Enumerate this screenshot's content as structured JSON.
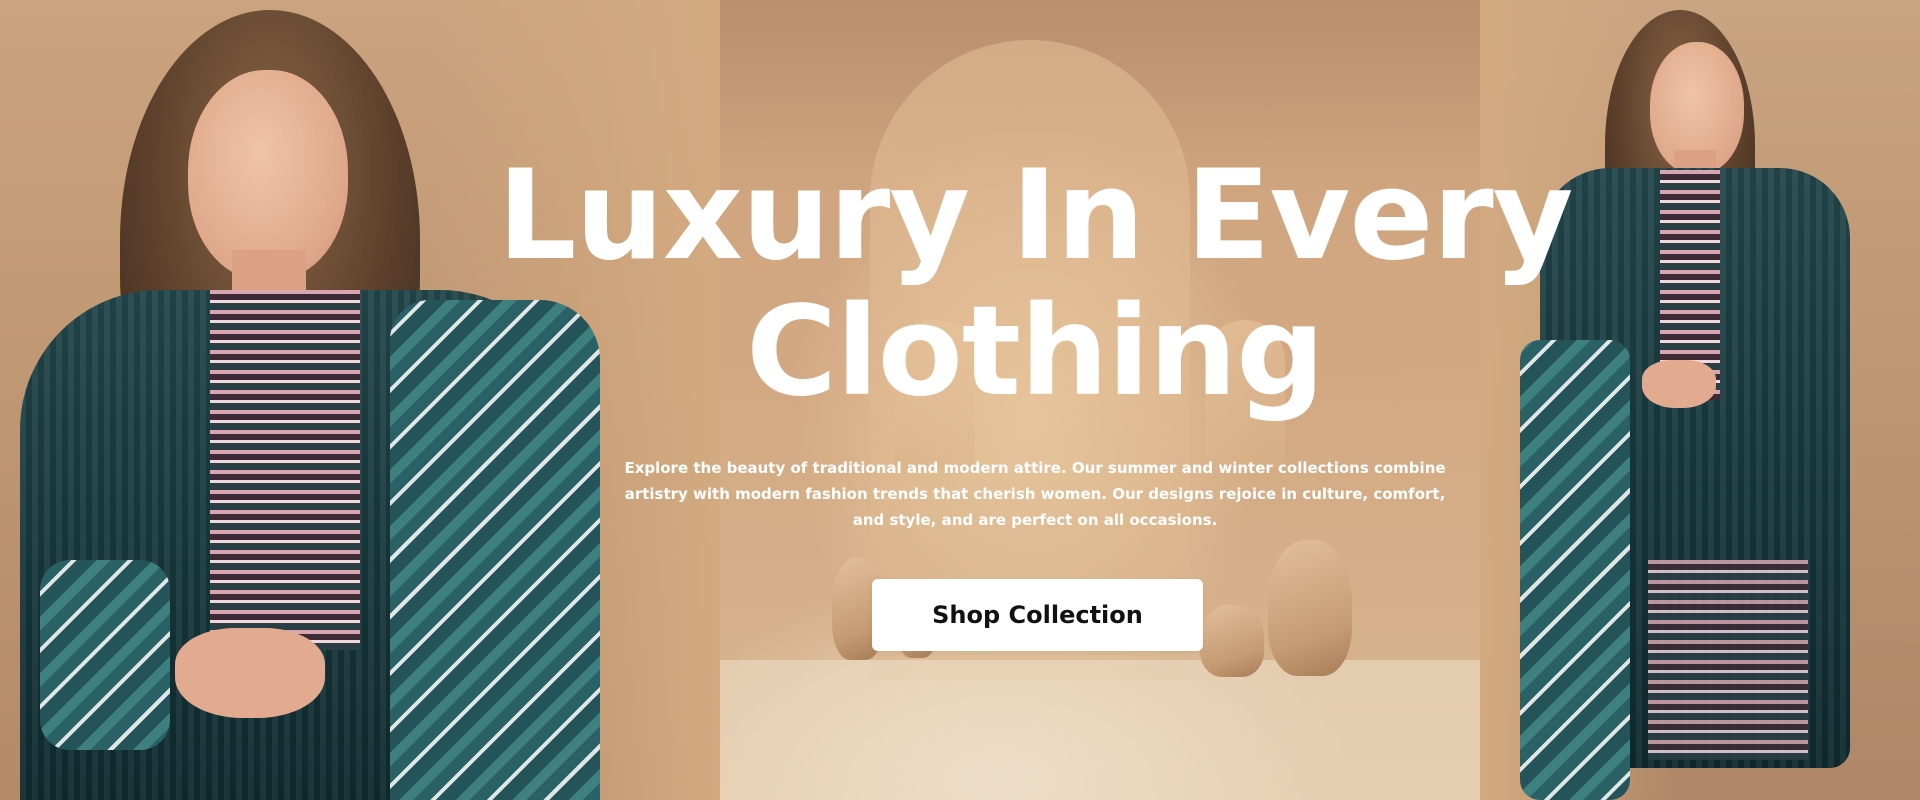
{
  "hero": {
    "headline": "Luxury In Every Clothing",
    "description": "Explore the beauty of traditional and modern attire. Our summer and winter collections combine artistry with modern fashion trends that cherish women. Our designs rejoice in culture, comfort, and style, and are perfect on all occasions.",
    "cta_label": "Shop Collection"
  },
  "colors": {
    "background_accent": "#d3aa84",
    "text": "#ffffff",
    "button_bg": "#ffffff",
    "button_text": "#111111",
    "outfit_teal": "#1c3f44"
  },
  "images": {
    "left_model": "model-in-teal-embroidered-suit-image",
    "right_model": "model-full-length-teal-suit-image"
  }
}
